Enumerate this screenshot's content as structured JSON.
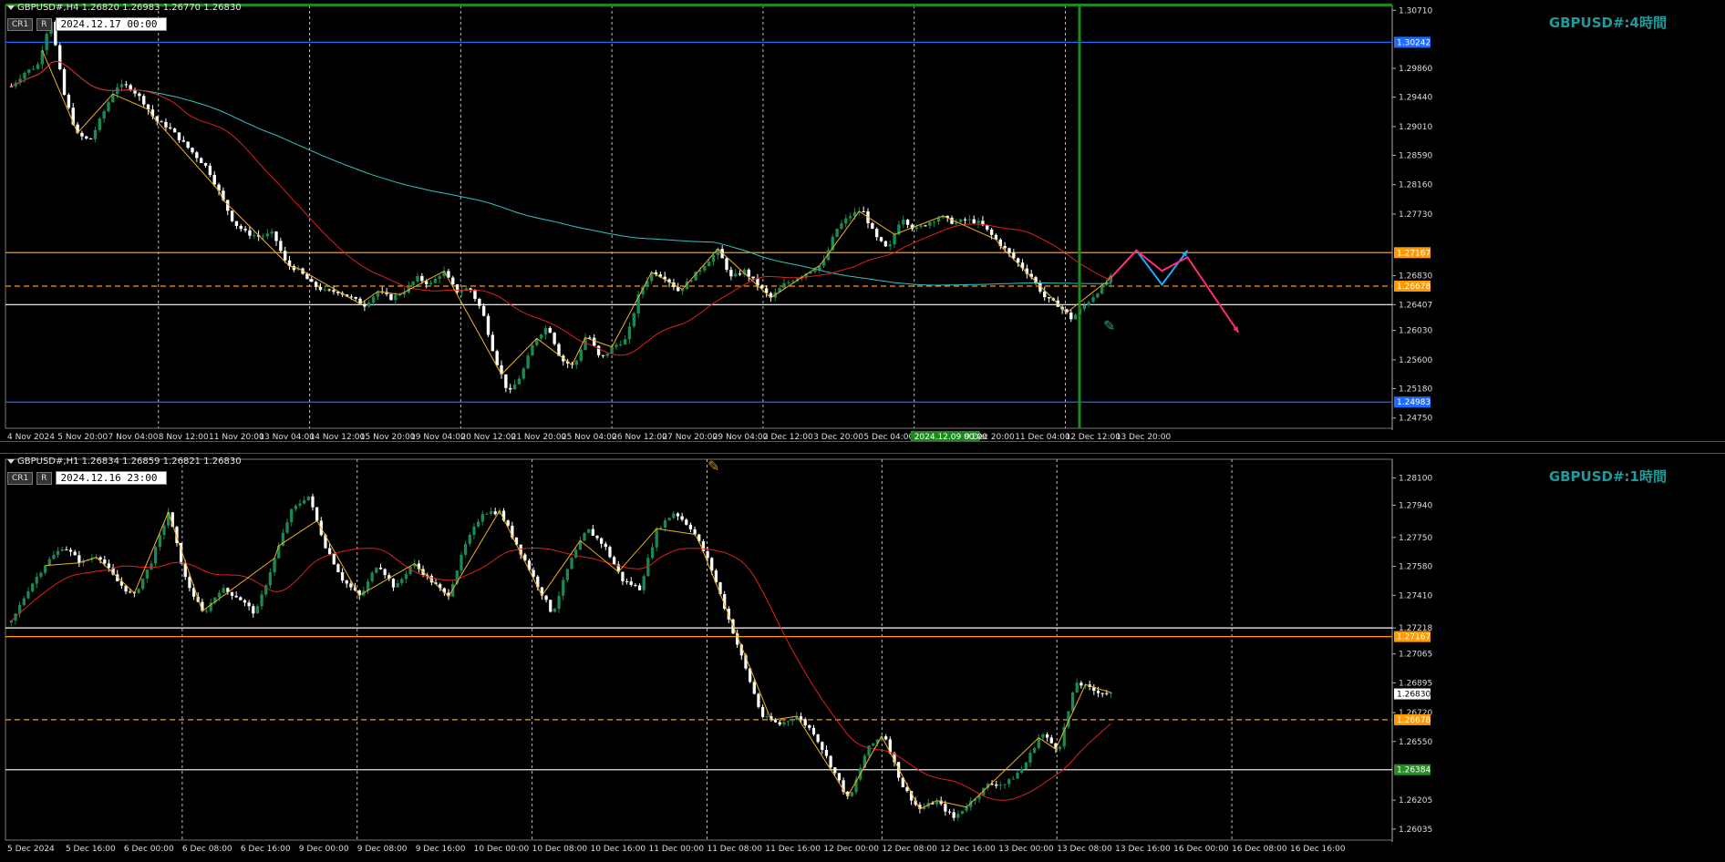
{
  "h4": {
    "symbol_line": "GBPUSD#,H4  1.26820 1.26983 1.26770 1.26830",
    "buttons": [
      "CR1",
      "R"
    ],
    "date_box": "2024.12.17 00:00",
    "pane_label": "GBPUSD#:4時間",
    "axis_labels": [
      "1.30710",
      "1.29860",
      "1.29440",
      "1.29010",
      "1.28590",
      "1.28160",
      "1.27730",
      "1.26830",
      "1.26407",
      "1.26030",
      "1.25600",
      "1.25180",
      "1.24750"
    ],
    "price_tags": [
      {
        "text": "1.30242",
        "color": "#1e6bff"
      },
      {
        "text": "1.27167",
        "color": "#ff9a00"
      },
      {
        "text": "1.26678",
        "color": "#ff9a00"
      },
      {
        "text": "1.24983",
        "color": "#1e6bff"
      }
    ],
    "time_labels": [
      "4 Nov 2024",
      "5 Nov 20:00",
      "7 Nov 04:00",
      "8 Nov 12:00",
      "11 Nov 20:00",
      "13 Nov 04:00",
      "14 Nov 12:00",
      "15 Nov 20:00",
      "19 Nov 04:00",
      "20 Nov 12:00",
      "21 Nov 20:00",
      "25 Nov 04:00",
      "26 Nov 12:00",
      "27 Nov 20:00",
      "29 Nov 04:00",
      "2 Dec 12:00",
      "3 Dec 20:00",
      "5 Dec 04:00",
      "2024.12.09 00:00",
      "9 Dec 20:00",
      "11 Dec 04:00",
      "12 Dec 12:00",
      "13 Dec 20:00"
    ],
    "highlight_time": "2024.12.09 00:00"
  },
  "h1": {
    "symbol_line": "GBPUSD#,H1  1.26834 1.26859 1.26821 1.26830",
    "buttons": [
      "CR1",
      "R"
    ],
    "date_box": "2024.12.16 23:00",
    "pane_label": "GBPUSD#:1時間",
    "axis_labels": [
      "1.28100",
      "1.27940",
      "1.27750",
      "1.27580",
      "1.27410",
      "1.27218",
      "1.27065",
      "1.26895",
      "1.26720",
      "1.26550",
      "1.26205",
      "1.26035"
    ],
    "price_tags": [
      {
        "text": "1.27167",
        "color": "#ff9a00"
      },
      {
        "text": "1.26830",
        "color": "#ffffff"
      },
      {
        "text": "1.26678",
        "color": "#ff9a00"
      },
      {
        "text": "1.26384",
        "color": "#2a8a2a"
      }
    ],
    "time_labels": [
      "5 Dec 2024",
      "5 Dec 16:00",
      "6 Dec 00:00",
      "6 Dec 08:00",
      "6 Dec 16:00",
      "9 Dec 00:00",
      "9 Dec 08:00",
      "9 Dec 16:00",
      "10 Dec 00:00",
      "10 Dec 08:00",
      "10 Dec 16:00",
      "11 Dec 00:00",
      "11 Dec 08:00",
      "11 Dec 16:00",
      "12 Dec 00:00",
      "12 Dec 08:00",
      "12 Dec 16:00",
      "13 Dec 00:00",
      "13 Dec 08:00",
      "13 Dec 16:00",
      "16 Dec 00:00",
      "16 Dec 08:00",
      "16 Dec 16:00"
    ]
  },
  "colors": {
    "bull": "#1a8a55",
    "bear": "#ffffff",
    "ma_slow": "#2fc5c5",
    "ma_fast": "#e02020",
    "zigzag": "#f0b020",
    "level_orange": "#ff9a00",
    "level_white": "#ffffff",
    "level_blue": "#1e6bff",
    "scenario_up": "#22aaff",
    "scenario_down": "#ff2a7a",
    "highlight": "#1a8a1a"
  },
  "chart_data": [
    {
      "type": "candlestick",
      "timeframe": "H4",
      "y_range": [
        1.246,
        1.3078
      ],
      "levels": [
        {
          "price": 1.30242,
          "style": "solid",
          "color": "#1e6bff"
        },
        {
          "price": 1.27167,
          "style": "solid",
          "color": "#ff9a00"
        },
        {
          "price": 1.26678,
          "style": "dashed",
          "color": "#ff9a00"
        },
        {
          "price": 1.26407,
          "style": "solid",
          "color": "#ffffff"
        },
        {
          "price": 1.24983,
          "style": "solid",
          "color": "#1e6bff"
        }
      ],
      "path_close": [
        1.296,
        1.298,
        1.299,
        1.306,
        1.295,
        1.289,
        1.288,
        1.292,
        1.296,
        1.296,
        1.294,
        1.291,
        1.29,
        1.288,
        1.286,
        1.284,
        1.28,
        1.276,
        1.2745,
        1.274,
        1.2745,
        1.27,
        1.269,
        1.267,
        1.266,
        1.266,
        1.265,
        1.264,
        1.266,
        1.265,
        1.266,
        1.268,
        1.267,
        1.269,
        1.266,
        1.2665,
        1.263,
        1.256,
        1.251,
        1.254,
        1.259,
        1.261,
        1.256,
        1.255,
        1.26,
        1.256,
        1.258,
        1.259,
        1.266,
        1.269,
        1.268,
        1.266,
        1.268,
        1.27,
        1.272,
        1.268,
        1.269,
        1.267,
        1.265,
        1.267,
        1.268,
        1.269,
        1.27,
        1.275,
        1.277,
        1.278,
        1.274,
        1.272,
        1.277,
        1.275,
        1.276,
        1.277,
        1.276,
        1.2765,
        1.276,
        1.274,
        1.272,
        1.27,
        1.268,
        1.265,
        1.264,
        1.262,
        1.264,
        1.266,
        1.268
      ],
      "scenario_up": [
        [
          1.268,
          0
        ],
        [
          1.272,
          1
        ],
        [
          1.267,
          2
        ],
        [
          1.272,
          3
        ]
      ],
      "scenario_down": [
        [
          1.268,
          0
        ],
        [
          1.272,
          1
        ],
        [
          1.269,
          2
        ],
        [
          1.271,
          3
        ],
        [
          1.26,
          5
        ]
      ]
    },
    {
      "type": "candlestick",
      "timeframe": "H1",
      "y_range": [
        1.2597,
        1.2821
      ],
      "levels": [
        {
          "price": 1.27218,
          "style": "solid",
          "color": "#ffffff"
        },
        {
          "price": 1.27167,
          "style": "solid",
          "color": "#ff9a00"
        },
        {
          "price": 1.26678,
          "style": "dashed",
          "color": "#ff9a00"
        },
        {
          "price": 1.26384,
          "style": "solid",
          "color": "#e6e6e6"
        }
      ],
      "path_close": [
        1.2725,
        1.2745,
        1.276,
        1.277,
        1.276,
        1.2765,
        1.275,
        1.274,
        1.276,
        1.279,
        1.275,
        1.273,
        1.2745,
        1.274,
        1.273,
        1.276,
        1.279,
        1.28,
        1.277,
        1.275,
        1.274,
        1.276,
        1.2745,
        1.276,
        1.275,
        1.274,
        1.277,
        1.279,
        1.279,
        1.277,
        1.275,
        1.273,
        1.276,
        1.278,
        1.277,
        1.275,
        1.2745,
        1.278,
        1.279,
        1.278,
        1.276,
        1.273,
        1.27,
        1.267,
        1.2665,
        1.267,
        1.266,
        1.264,
        1.262,
        1.265,
        1.266,
        1.263,
        1.2615,
        1.262,
        1.261,
        1.262,
        1.263,
        1.263,
        1.264,
        1.266,
        1.265,
        1.269,
        1.2685,
        1.2683
      ]
    }
  ]
}
